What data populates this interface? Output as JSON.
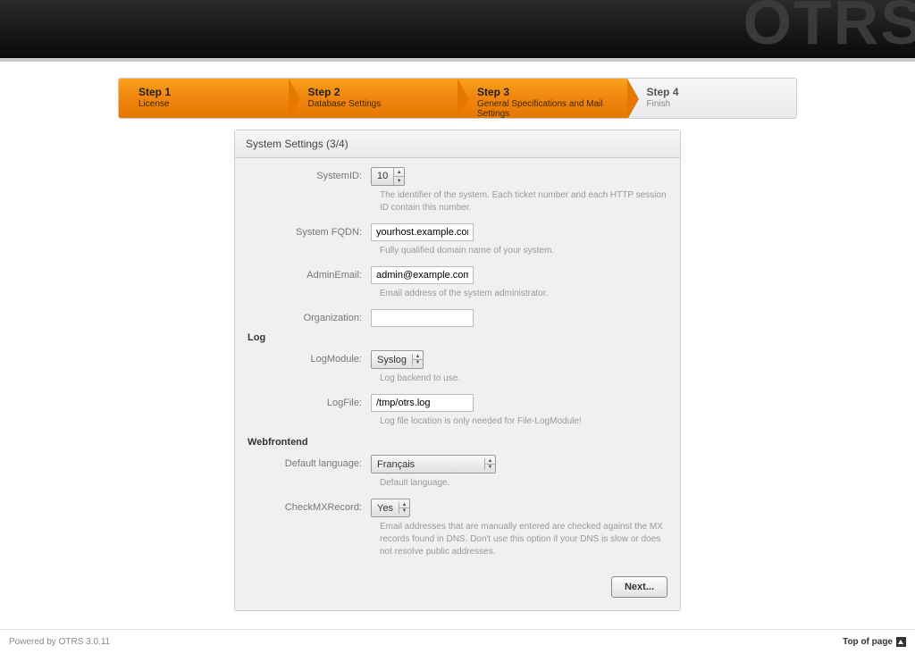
{
  "header": {
    "logo": "OTRS"
  },
  "steps": [
    {
      "title": "Step 1",
      "desc": "License",
      "active": true
    },
    {
      "title": "Step 2",
      "desc": "Database Settings",
      "active": true
    },
    {
      "title": "Step 3",
      "desc": "General Specifications and Mail Settings",
      "active": true
    },
    {
      "title": "Step 4",
      "desc": "Finish",
      "active": false
    }
  ],
  "panel": {
    "title": "System Settings (3/4)",
    "fields": {
      "systemid": {
        "label": "SystemID:",
        "value": "10",
        "help": "The identifier of the system. Each ticket number and each HTTP session ID contain this number."
      },
      "fqdn": {
        "label": "System FQDN:",
        "value": "yourhost.example.com",
        "help": "Fully qualified domain name of your system."
      },
      "adminemail": {
        "label": "AdminEmail:",
        "value": "admin@example.com",
        "help": "Email address of the system administrator."
      },
      "organization": {
        "label": "Organization:",
        "value": ""
      },
      "log_heading": "Log",
      "logmodule": {
        "label": "LogModule:",
        "value": "Syslog",
        "help": "Log backend to use."
      },
      "logfile": {
        "label": "LogFile:",
        "value": "/tmp/otrs.log",
        "help": "Log file location is only needed for File-LogModule!"
      },
      "web_heading": "Webfrontend",
      "language": {
        "label": "Default language:",
        "value": "Français",
        "help": "Default language."
      },
      "checkmx": {
        "label": "CheckMXRecord:",
        "value": "Yes",
        "help": "Email addresses that are manually entered are checked against the MX records found in DNS. Don't use this option if your DNS is slow or does not resolve public addresses."
      }
    },
    "next_button": "Next..."
  },
  "footer": {
    "powered": "Powered by OTRS 3.0.11",
    "top": "Top of page"
  }
}
